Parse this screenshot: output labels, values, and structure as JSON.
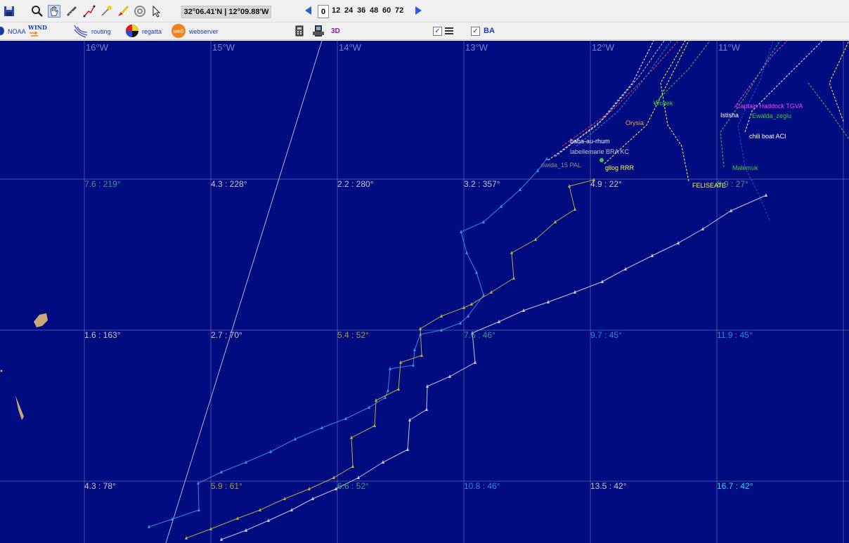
{
  "toolbar": {
    "save_icon": "save-icon",
    "tools": [
      "zoom-icon",
      "pan-hand-icon",
      "measure-icon",
      "route-line-icon",
      "waypoint-icon",
      "brush-icon",
      "target-icon",
      "pointer-icon"
    ],
    "coordinates": "32°06.41'N | 12°09.88'W",
    "forecast_hours": [
      "0",
      "12",
      "24",
      "36",
      "48",
      "60",
      "72"
    ]
  },
  "toolbar2": {
    "noaa": "NOAA",
    "wind": "WIND",
    "routing": "routing",
    "regatta": "regatta",
    "webserver": "webserver",
    "three_d": "3D",
    "ba": "BA"
  },
  "map": {
    "longitudes": [
      "16°W",
      "15°W",
      "14°W",
      "13°W",
      "12°W",
      "11°W"
    ],
    "wind_labels": [
      {
        "text": "7.6 : 219°",
        "color": "#3c9a8c"
      },
      {
        "text": "4.3 : 228°",
        "color": "#c8c8c8"
      },
      {
        "text": "2.2 : 280°",
        "color": "#c8c8c8"
      },
      {
        "text": "3.2 : 357°",
        "color": "#c8c8c8"
      },
      {
        "text": "4.9 : 22°",
        "color": "#c8c8c8"
      },
      {
        "text": "8.9 : 27°",
        "color": "#3c9a8c"
      },
      {
        "text": "1.6 : 163°",
        "color": "#c8c8c8"
      },
      {
        "text": "2.7 : 70°",
        "color": "#c8c8c8"
      },
      {
        "text": "5.4 : 52°",
        "color": "#a89a3a"
      },
      {
        "text": "7.6 : 46°",
        "color": "#3c9a8c"
      },
      {
        "text": "9.7 : 45°",
        "color": "#2a8cd8"
      },
      {
        "text": "11.9 : 45°",
        "color": "#2a8cd8"
      },
      {
        "text": "4.3 : 78°",
        "color": "#c8c8c8"
      },
      {
        "text": "5.9 : 61°",
        "color": "#a89a3a"
      },
      {
        "text": "6.6 : 52°",
        "color": "#3c9a8c"
      },
      {
        "text": "10.8 : 46°",
        "color": "#2a8cd8"
      },
      {
        "text": "13.5 : 42°",
        "color": "#c8c8c8"
      },
      {
        "text": "16.7 : 42°",
        "color": "#2ad8f0"
      }
    ],
    "boats": [
      {
        "name": "baba-au-rhum",
        "color": "#ffffff"
      },
      {
        "name": "labellemarie BRA KC",
        "color": "#c8c8c8"
      },
      {
        "name": "swida_15 PAL",
        "color": "#8c8c8c"
      },
      {
        "name": "gllog RRR",
        "color": "#ffff40"
      },
      {
        "name": "FELISEATE",
        "color": "#ffff40"
      },
      {
        "name": "Malemuk",
        "color": "#40c840"
      },
      {
        "name": "chili boat ACI",
        "color": "#ffffff"
      },
      {
        "name": "Captain Haddock TGVA",
        "color": "#ff40ff"
      },
      {
        "name": "Istisha",
        "color": "#ffffff"
      },
      {
        "name": "Wojtek",
        "color": "#40c840"
      },
      {
        "name": "Orysia",
        "color": "#ffa040"
      },
      {
        "name": "Ewalda_zeglu",
        "color": "#40c840"
      }
    ]
  }
}
